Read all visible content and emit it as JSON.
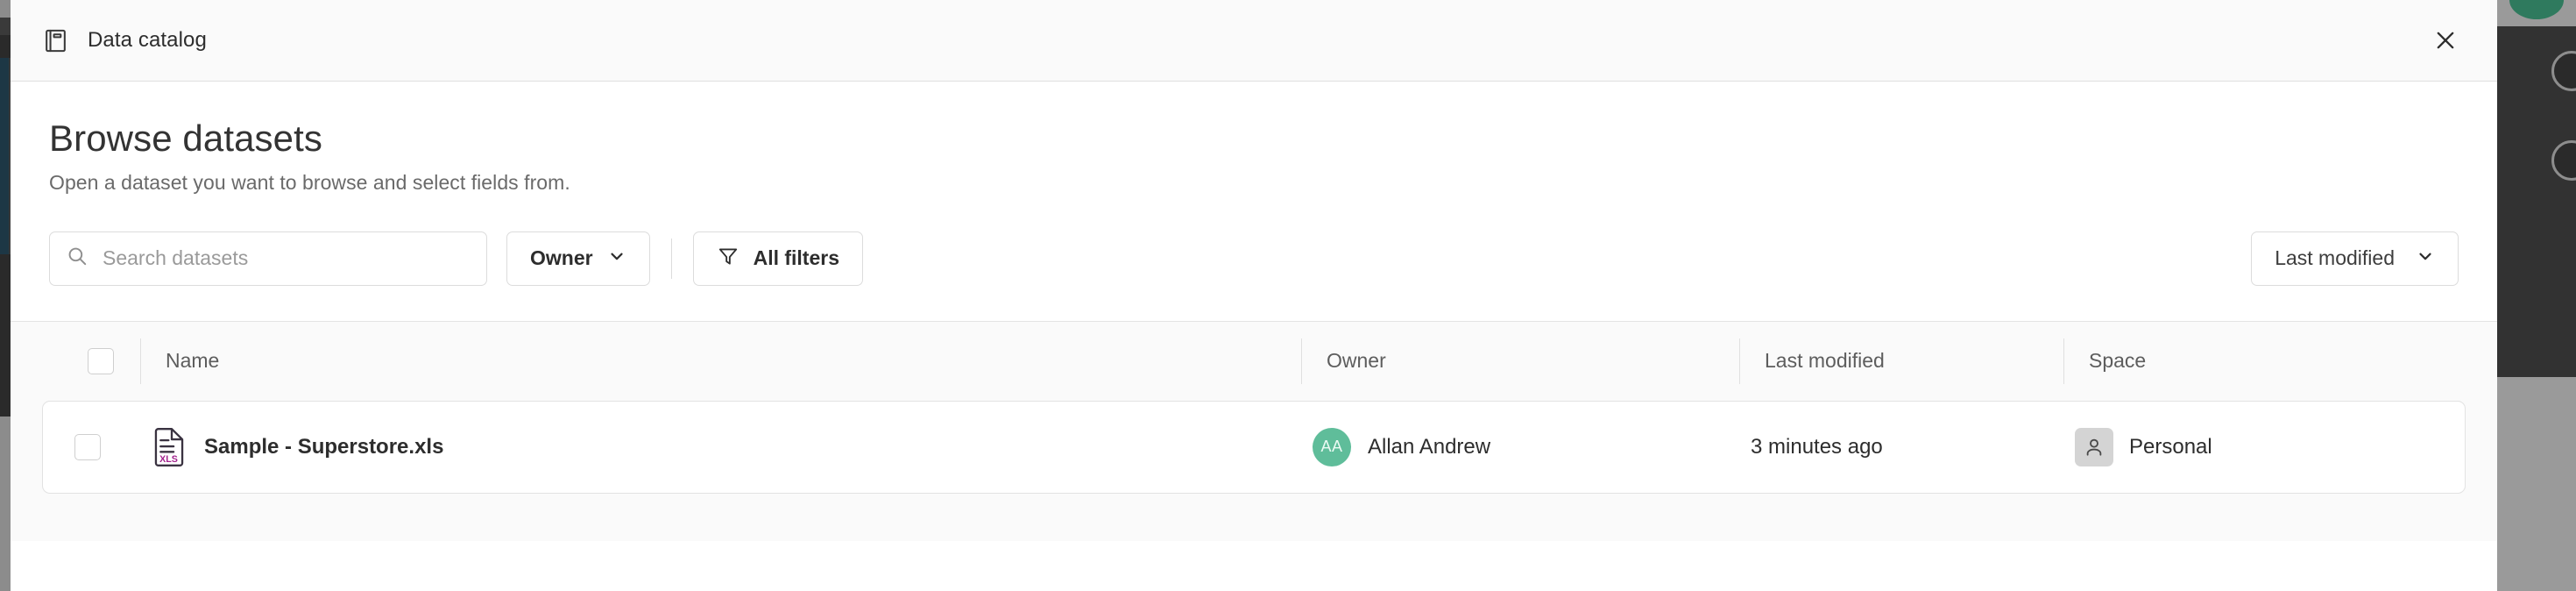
{
  "window": {
    "title": "Data catalog",
    "title_icon": "book-catalog-icon",
    "close_icon": "close-icon"
  },
  "page": {
    "heading": "Browse datasets",
    "subtitle": "Open a dataset you want to browse and select fields from."
  },
  "toolbar": {
    "search": {
      "icon": "search-icon",
      "placeholder": "Search datasets",
      "value": ""
    },
    "owner_filter": {
      "label": "Owner",
      "icon": "chevron-down-icon"
    },
    "all_filters": {
      "label": "All filters",
      "icon": "funnel-icon"
    },
    "sort": {
      "label": "Last modified",
      "icon": "chevron-down-icon"
    }
  },
  "table": {
    "columns": [
      {
        "key": "name",
        "label": "Name"
      },
      {
        "key": "owner",
        "label": "Owner"
      },
      {
        "key": "modified",
        "label": "Last modified"
      },
      {
        "key": "space",
        "label": "Space"
      }
    ],
    "select_all_checked": false,
    "rows": [
      {
        "checked": false,
        "file_icon": "xls-file-icon",
        "file_icon_label": "XLS",
        "name": "Sample - Superstore.xls",
        "owner_initials": "AA",
        "owner": "Allan Andrew",
        "modified": "3 minutes ago",
        "space_icon": "person-icon",
        "space": "Personal"
      }
    ]
  },
  "colors": {
    "avatar_green": "#5fbd9a",
    "xls_magenta": "#a3238e",
    "panel_bg": "#ffffff",
    "toolbar_bg": "#fafafa",
    "border": "#e0e0e0"
  }
}
